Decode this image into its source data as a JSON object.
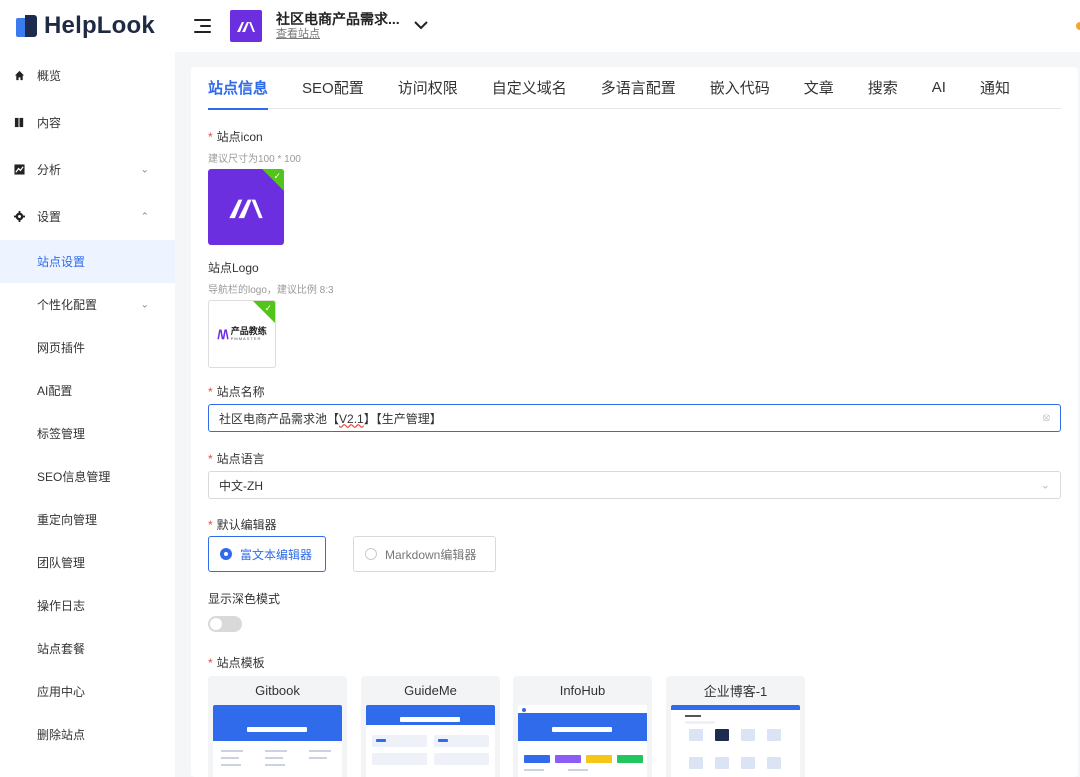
{
  "brand": {
    "name": "HelpLook"
  },
  "sidebar": {
    "items": [
      {
        "label": "概览"
      },
      {
        "label": "内容"
      },
      {
        "label": "分析"
      },
      {
        "label": "设置"
      }
    ],
    "sub_items": [
      {
        "label": "站点设置"
      },
      {
        "label": "个性化配置"
      },
      {
        "label": "网页插件"
      },
      {
        "label": "AI配置"
      },
      {
        "label": "标签管理"
      },
      {
        "label": "SEO信息管理"
      },
      {
        "label": "重定向管理"
      },
      {
        "label": "团队管理"
      },
      {
        "label": "操作日志"
      },
      {
        "label": "站点套餐"
      },
      {
        "label": "应用中心"
      },
      {
        "label": "删除站点"
      }
    ]
  },
  "header": {
    "site_title": "社区电商产品需求...",
    "site_link": "查看站点"
  },
  "tabs": [
    {
      "label": "站点信息"
    },
    {
      "label": "SEO配置"
    },
    {
      "label": "访问权限"
    },
    {
      "label": "自定义域名"
    },
    {
      "label": "多语言配置"
    },
    {
      "label": "嵌入代码"
    },
    {
      "label": "文章"
    },
    {
      "label": "搜索"
    },
    {
      "label": "AI"
    },
    {
      "label": "通知"
    }
  ],
  "form": {
    "required_mark": "*",
    "icon_label": "站点icon",
    "icon_hint": "建议尺寸为100 * 100",
    "logo_label": "站点Logo",
    "logo_hint": "导航栏的logo，建议比例 8:3",
    "logo_text": "产品教练",
    "logo_subtext": "PMMASTER",
    "name_label": "站点名称",
    "name_prefix": "社区电商产品需求池【",
    "name_version": "V2.1",
    "name_suffix": "】【生产管理】",
    "lang_label": "站点语言",
    "lang_value": "中文-ZH",
    "editor_label": "默认编辑器",
    "editor_options": [
      {
        "label": "富文本编辑器"
      },
      {
        "label": "Markdown编辑器"
      }
    ],
    "dark_label": "显示深色模式",
    "template_label": "站点模板",
    "templates": [
      {
        "name": "Gitbook"
      },
      {
        "name": "GuideMe"
      },
      {
        "name": "InfoHub"
      },
      {
        "name": "企业博客-1"
      }
    ]
  },
  "colors": {
    "accent": "#2f6bea",
    "site_avatar": "#6b2fe0",
    "success": "#52c41a",
    "required": "#e74c3c"
  }
}
